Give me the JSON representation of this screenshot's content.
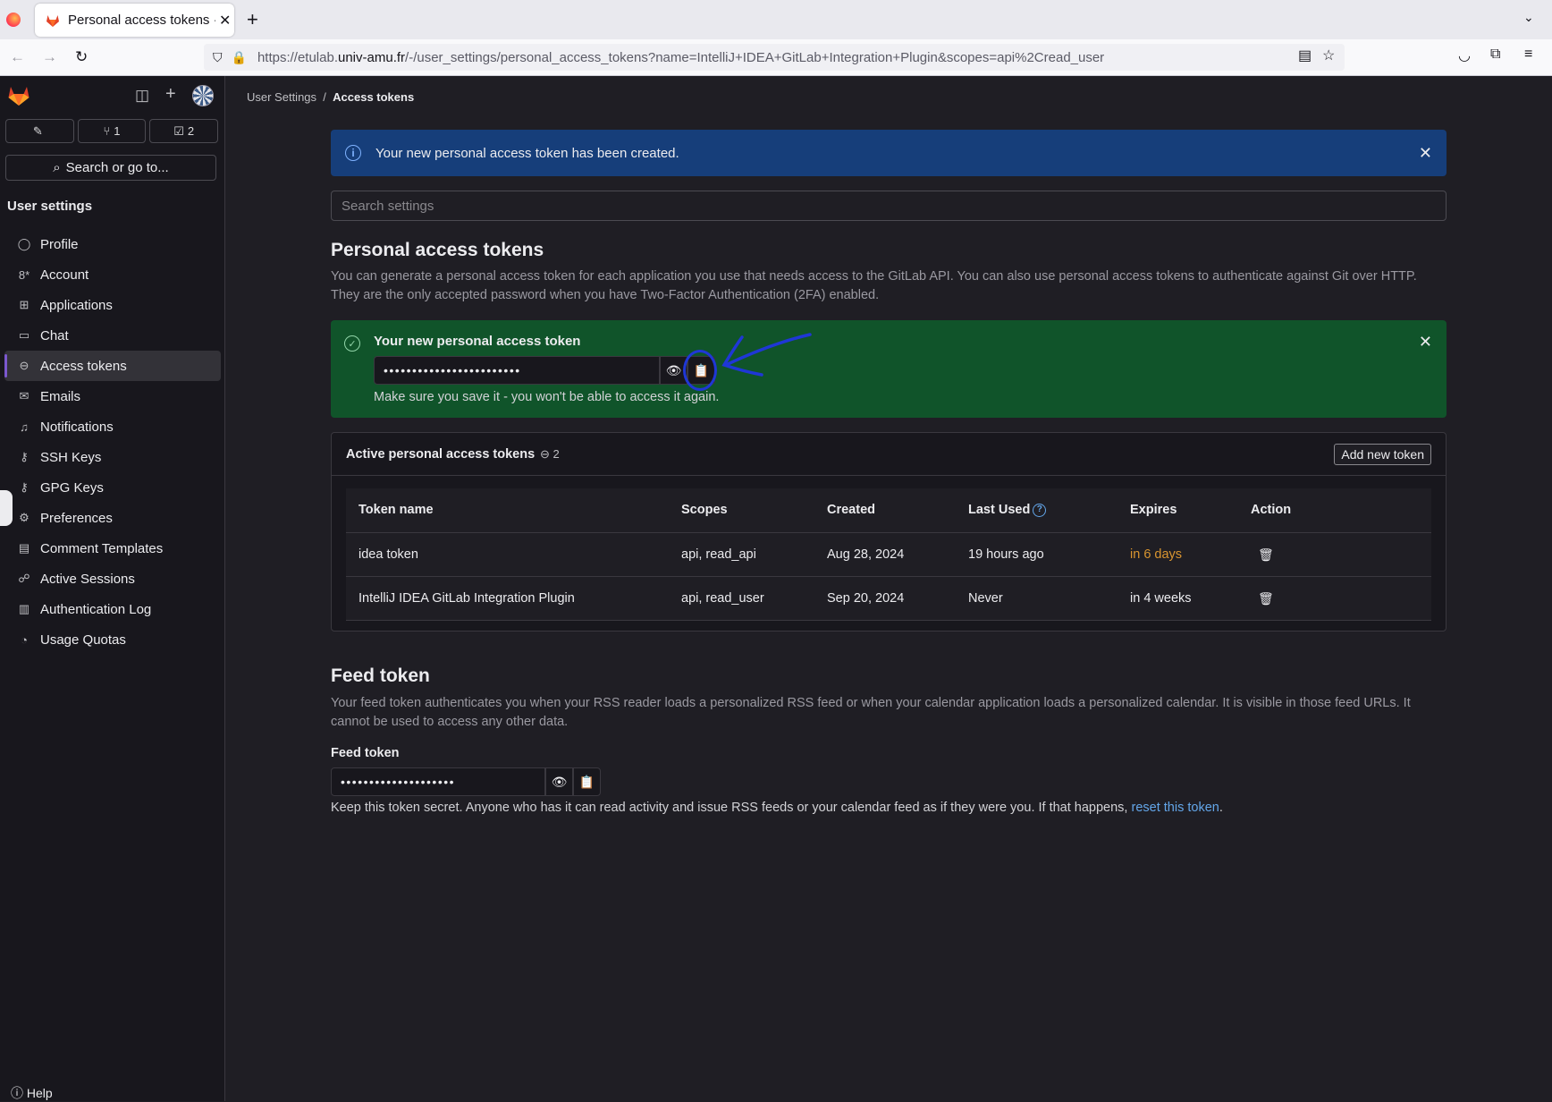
{
  "browser": {
    "tab_title": "Personal access tokens · User Settings · GitLab",
    "url_prefix": "https://etulab.",
    "url_domain": "univ-amu.fr",
    "url_suffix": "/-/user_settings/personal_access_tokens?name=IntelliJ+IDEA+GitLab+Integration+Plugin&scopes=api%2Cread_user",
    "close_glyph": "✕",
    "new_tab_glyph": "+"
  },
  "sidebar": {
    "counts": {
      "issues": "",
      "merge_requests": "1",
      "todos": "2"
    },
    "search_label": "Search or go to...",
    "heading": "User settings",
    "items": [
      {
        "label": "Profile",
        "icon": "user-icon",
        "glyph": "◯"
      },
      {
        "label": "Account",
        "icon": "account-icon",
        "glyph": "8*"
      },
      {
        "label": "Applications",
        "icon": "applications-icon",
        "glyph": "⊞"
      },
      {
        "label": "Chat",
        "icon": "chat-icon",
        "glyph": "▭"
      },
      {
        "label": "Access tokens",
        "icon": "token-icon",
        "glyph": "⊖",
        "active": true
      },
      {
        "label": "Emails",
        "icon": "mail-icon",
        "glyph": "✉"
      },
      {
        "label": "Notifications",
        "icon": "bell-icon",
        "glyph": "♫"
      },
      {
        "label": "SSH Keys",
        "icon": "key-icon",
        "glyph": "⚷"
      },
      {
        "label": "GPG Keys",
        "icon": "key-icon",
        "glyph": "⚷"
      },
      {
        "label": "Preferences",
        "icon": "preferences-icon",
        "glyph": "⚙"
      },
      {
        "label": "Comment Templates",
        "icon": "comment-icon",
        "glyph": "▤"
      },
      {
        "label": "Active Sessions",
        "icon": "sessions-icon",
        "glyph": "☍"
      },
      {
        "label": "Authentication Log",
        "icon": "log-icon",
        "glyph": "▥"
      },
      {
        "label": "Usage Quotas",
        "icon": "quota-icon",
        "glyph": "◔"
      }
    ],
    "help_label": "Help"
  },
  "breadcrumb": {
    "parent": "User Settings",
    "separator": "/",
    "current": "Access tokens"
  },
  "info_alert": {
    "text": "Your new personal access token has been created."
  },
  "settings_search": {
    "placeholder": "Search settings"
  },
  "pat": {
    "title": "Personal access tokens",
    "description": "You can generate a personal access token for each application you use that needs access to the GitLab API. You can also use personal access tokens to authenticate against Git over HTTP. They are the only accepted password when you have Two-Factor Authentication (2FA) enabled.",
    "new_token": {
      "title": "Your new personal access token",
      "masked_value": "••••••••••••••••••••••••",
      "note": "Make sure you save it - you won't be able to access it again."
    }
  },
  "active_tokens": {
    "title": "Active personal access tokens",
    "count": "2",
    "add_button": "Add new token",
    "columns": [
      "Token name",
      "Scopes",
      "Created",
      "Last Used",
      "Expires",
      "Action"
    ],
    "rows": [
      {
        "name": "idea token",
        "scopes": "api, read_api",
        "created": "Aug 28, 2024",
        "last_used": "19 hours ago",
        "expires": "in 6 days",
        "expires_warning": true
      },
      {
        "name": "IntelliJ IDEA GitLab Integration Plugin",
        "scopes": "api, read_user",
        "created": "Sep 20, 2024",
        "last_used": "Never",
        "expires": "in 4 weeks",
        "expires_warning": false
      }
    ]
  },
  "feed": {
    "title": "Feed token",
    "description": "Your feed token authenticates you when your RSS reader loads a personalized RSS feed or when your calendar application loads a personalized calendar. It is visible in those feed URLs. It cannot be used to access any other data.",
    "label": "Feed token",
    "masked_value": "••••••••••••••••••••",
    "help_text": "Keep this token secret. Anyone who has it can read activity and issue RSS feeds or your calendar feed as if they were you. If that happens,",
    "reset_link": "reset this token",
    "help_end": "."
  },
  "colors": {
    "info": "#163e7a",
    "success": "#10542a",
    "warning": "#d99530",
    "link": "#63a6e9",
    "annotation": "#1f37d6"
  }
}
